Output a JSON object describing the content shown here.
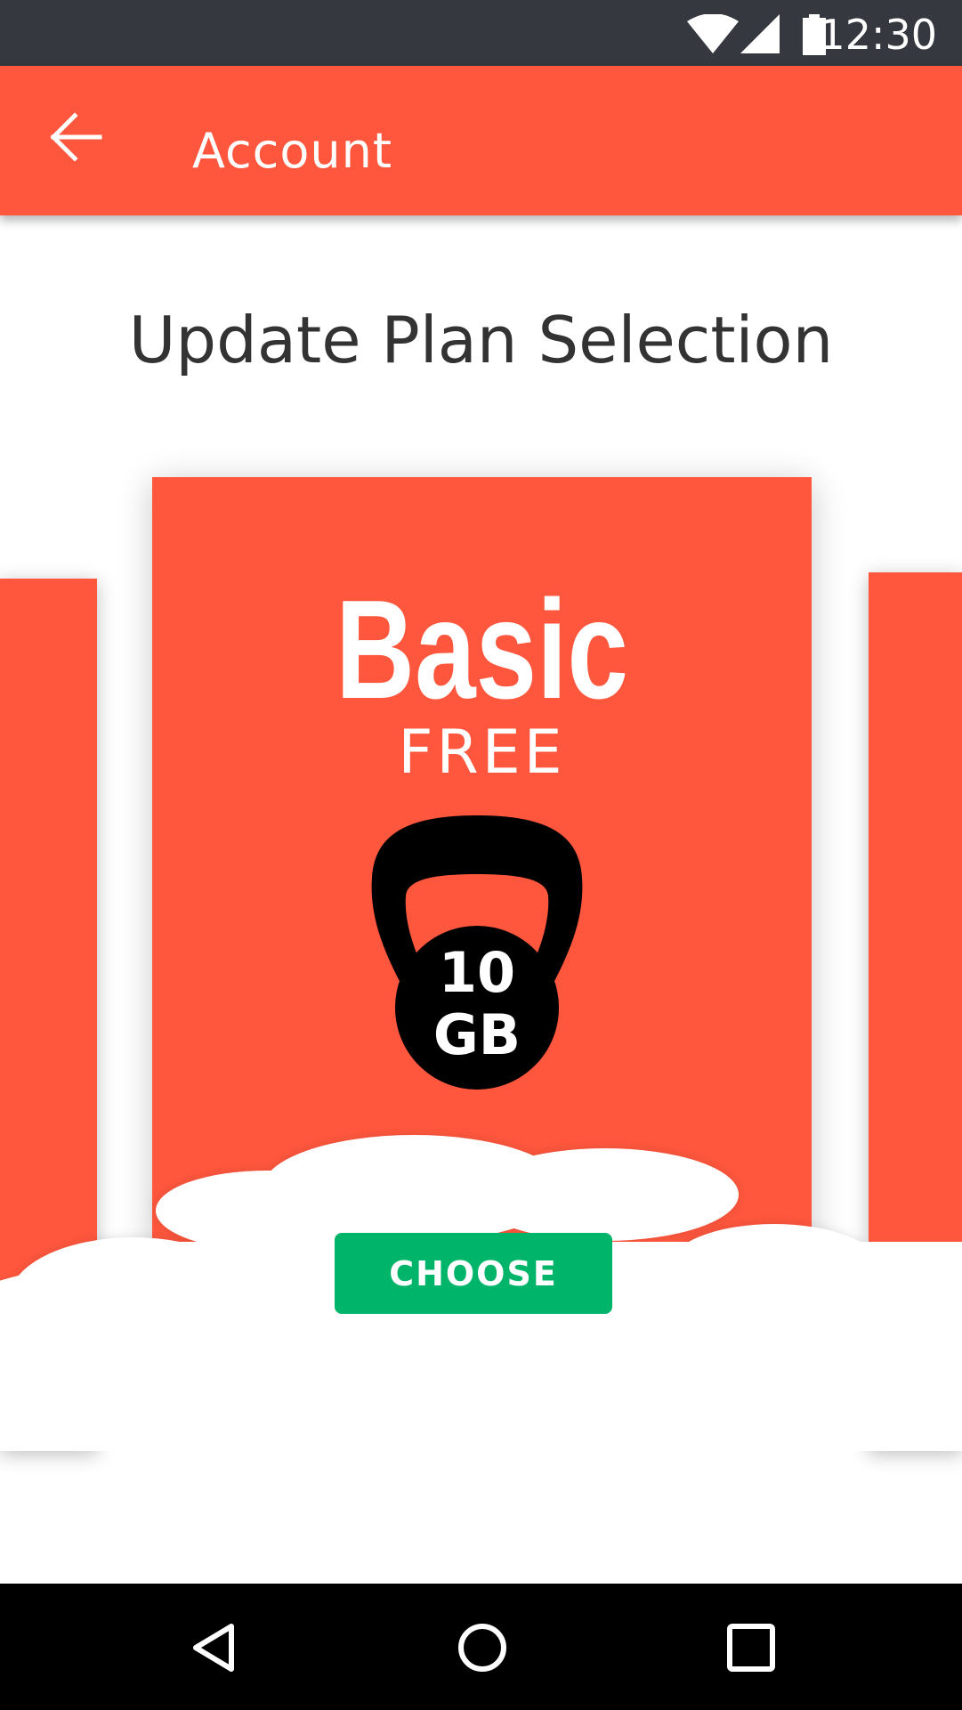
{
  "status_bar": {
    "time": "12:30",
    "icons": [
      "wifi-icon",
      "cellular-signal-icon",
      "battery-icon"
    ]
  },
  "app_bar": {
    "title": "Account",
    "back_icon": "arrow-left-icon",
    "background_color": "#ff573d"
  },
  "page": {
    "heading": "Update Plan Selection"
  },
  "plan_card": {
    "name": "Basic",
    "price": "FREE",
    "storage_value": "10",
    "storage_unit": "GB",
    "icon": "kettlebell-icon",
    "button_label": "CHOOSE",
    "button_color": "#00b46a"
  },
  "nav_bar": {
    "icons": [
      "back-triangle-icon",
      "home-circle-icon",
      "recents-square-icon"
    ]
  }
}
